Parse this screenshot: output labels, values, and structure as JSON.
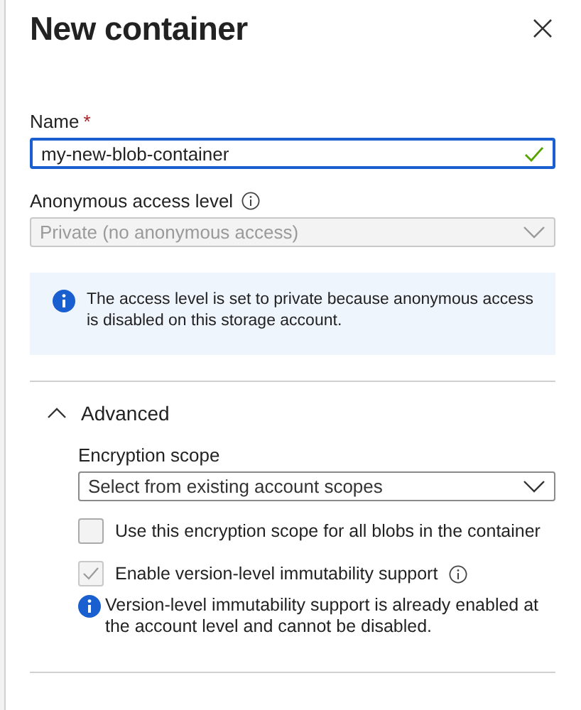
{
  "panel": {
    "title": "New container"
  },
  "name_field": {
    "label": "Name",
    "required_mark": "*",
    "value": "my-new-blob-container",
    "valid": true
  },
  "access_level": {
    "label": "Anonymous access level",
    "value": "Private (no anonymous access)",
    "disabled": true
  },
  "info_message": "The access level is set to private because anonymous access is disabled on this storage account.",
  "advanced": {
    "label": "Advanced",
    "expanded": true,
    "encryption_scope": {
      "label": "Encryption scope",
      "placeholder": "Select from existing account scopes"
    },
    "options": [
      {
        "label": "Use this encryption scope for all blobs in the container",
        "checked": false,
        "disabled": false,
        "has_info": false
      },
      {
        "label": "Enable version-level immutability support",
        "checked": true,
        "disabled": true,
        "has_info": true
      }
    ],
    "note": "Version-level immutability support is already enabled at the account level and cannot be disabled."
  }
}
